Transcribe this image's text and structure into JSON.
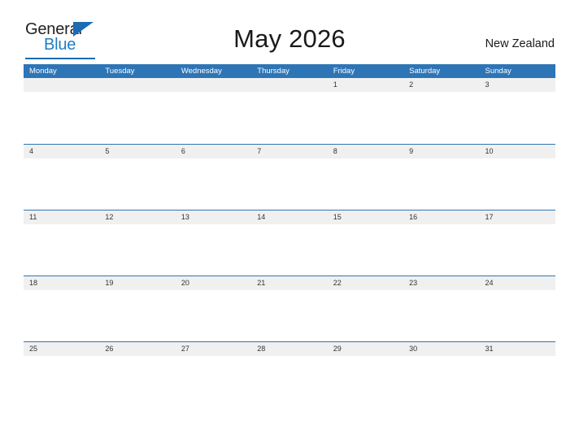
{
  "brand": {
    "name_part1": "General",
    "name_part2": "Blue",
    "colors": {
      "dark": "#231f20",
      "blue": "#1d7dc4",
      "triangle": "#1b6cb3"
    }
  },
  "header": {
    "title": "May 2026",
    "region": "New Zealand"
  },
  "calendar": {
    "header_color": "#2e75b6",
    "band_color": "#f0f0f0",
    "weekdays": [
      "Monday",
      "Tuesday",
      "Wednesday",
      "Thursday",
      "Friday",
      "Saturday",
      "Sunday"
    ],
    "weeks": [
      [
        "",
        "",
        "",
        "",
        "1",
        "2",
        "3"
      ],
      [
        "4",
        "5",
        "6",
        "7",
        "8",
        "9",
        "10"
      ],
      [
        "11",
        "12",
        "13",
        "14",
        "15",
        "16",
        "17"
      ],
      [
        "18",
        "19",
        "20",
        "21",
        "22",
        "23",
        "24"
      ],
      [
        "25",
        "26",
        "27",
        "28",
        "29",
        "30",
        "31"
      ]
    ]
  }
}
